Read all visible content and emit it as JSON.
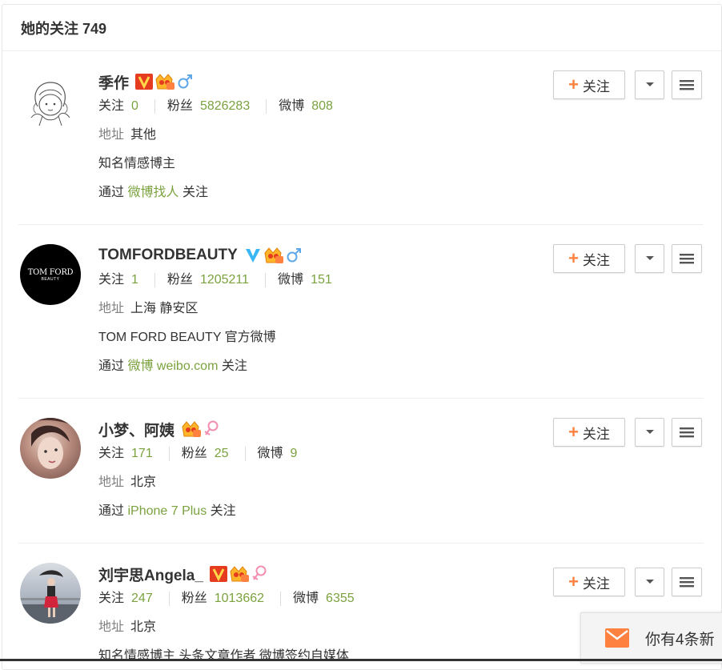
{
  "header": {
    "title": "她的关注 749"
  },
  "labels": {
    "follow_btn": "关注",
    "follows": "关注",
    "fans": "粉丝",
    "posts": "微博",
    "address": "地址",
    "via_prefix": "通过",
    "via_suffix": "关注"
  },
  "users": [
    {
      "name": "季作",
      "follows": "0",
      "fans": "5826283",
      "posts": "808",
      "address": "其他",
      "bio": "知名情感博主",
      "via": "微博找人"
    },
    {
      "name": "TOMFORDBEAUTY",
      "avatar_text_1": "TOM FORD",
      "avatar_text_2": "BEAUTY",
      "follows": "1",
      "fans": "1205211",
      "posts": "151",
      "address": "上海 静安区",
      "bio": "TOM FORD BEAUTY 官方微博",
      "via": "微博 weibo.com"
    },
    {
      "name": "小梦、阿姨",
      "follows": "171",
      "fans": "25",
      "posts": "9",
      "address": "北京",
      "via": "iPhone 7 Plus"
    },
    {
      "name": "刘宇思Angela_",
      "follows": "247",
      "fans": "1013662",
      "posts": "6355",
      "address": "北京",
      "bio": "知名情感博主 头条文章作者 微博签约自媒体"
    }
  ],
  "toast": {
    "text": "你有4条新"
  },
  "colors": {
    "accent_green": "#7ba23f",
    "plus_orange": "#ff8140",
    "mail_orange": "#ff8140"
  }
}
